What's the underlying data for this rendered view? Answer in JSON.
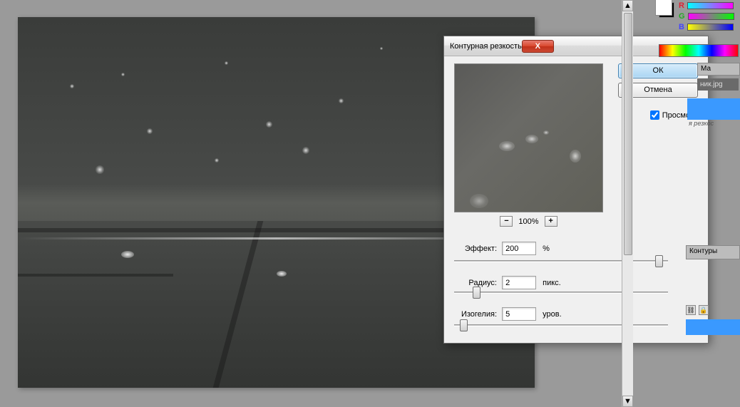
{
  "dialog": {
    "title": "Контурная резкость",
    "ok_label": "ОК",
    "cancel_label": "Отмена",
    "preview_label": "Просмотр",
    "preview_checked": true,
    "zoom_level": "100%",
    "params": {
      "amount": {
        "label": "Эффект:",
        "value": "200",
        "unit": "%"
      },
      "radius": {
        "label": "Радиус:",
        "value": "2",
        "unit": "пикс."
      },
      "threshold": {
        "label": "Изогелия:",
        "value": "5",
        "unit": "уров."
      }
    }
  },
  "right_panel": {
    "channels": {
      "r": "R",
      "g": "G",
      "b": "B"
    },
    "tabs": {
      "masks": "Ма",
      "contours": "Контуры"
    },
    "filename": "ник.jpg",
    "layer_hint": "я резкос"
  },
  "icons": {
    "close": "X",
    "minus": "−",
    "plus": "+",
    "arrow_up": "▲",
    "arrow_down": "▼",
    "link": "⛓",
    "lock": "🔒"
  }
}
